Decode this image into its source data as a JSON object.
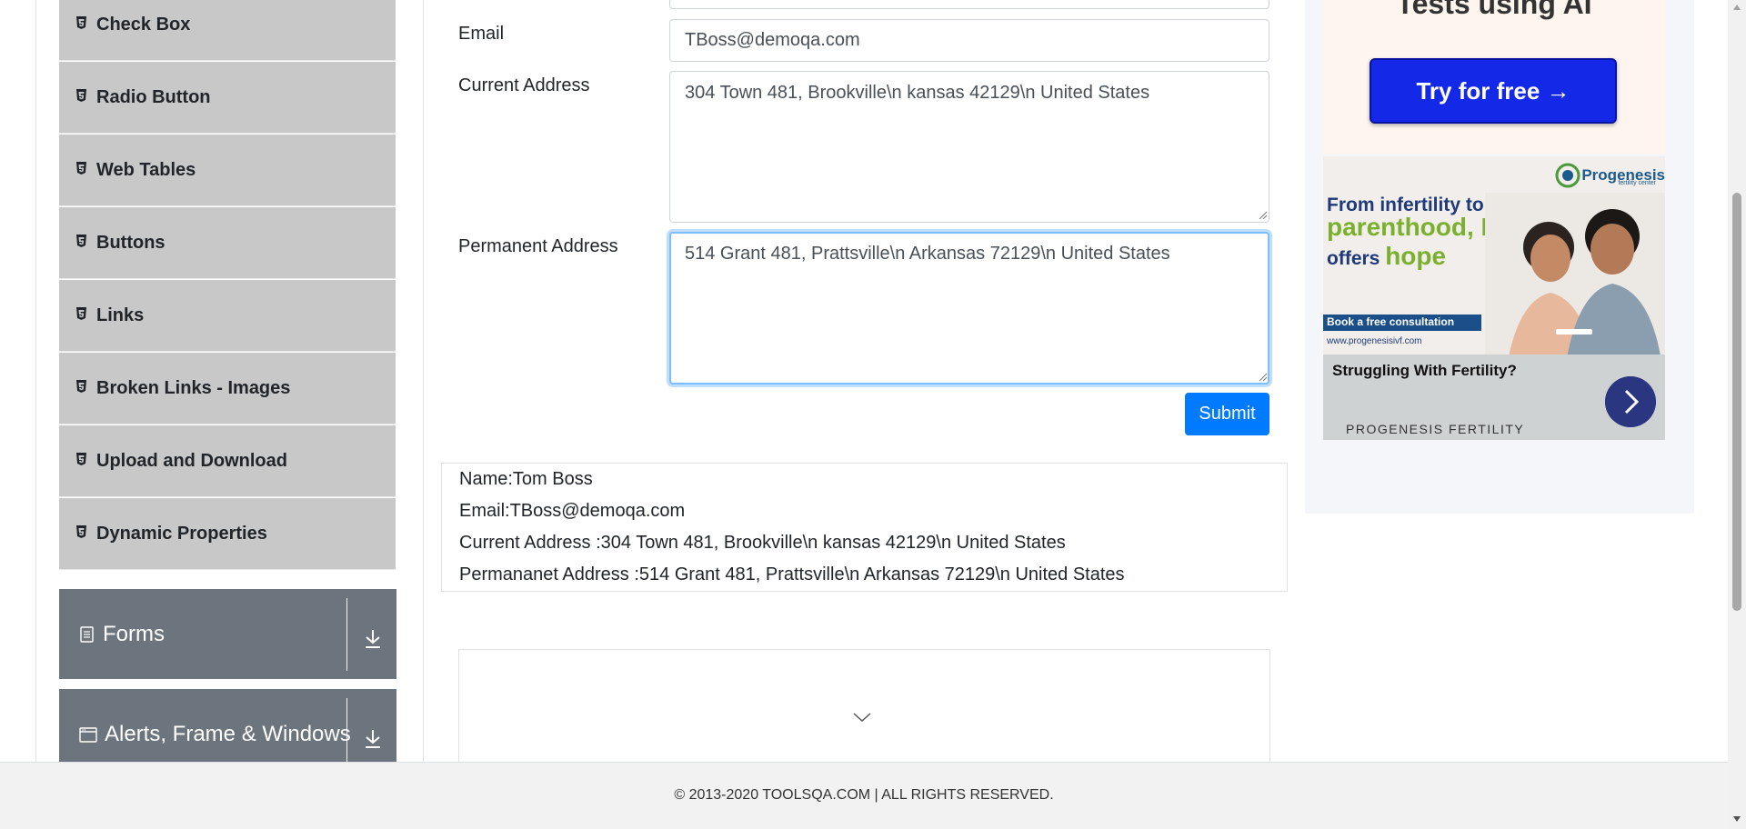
{
  "sidebar": {
    "elements_items": [
      {
        "label": "Check Box"
      },
      {
        "label": "Radio Button"
      },
      {
        "label": "Web Tables"
      },
      {
        "label": "Buttons"
      },
      {
        "label": "Links"
      },
      {
        "label": "Broken Links - Images"
      },
      {
        "label": "Upload and Download"
      },
      {
        "label": "Dynamic Properties"
      }
    ],
    "groups": [
      {
        "label": "Forms"
      },
      {
        "label": "Alerts, Frame & Windows"
      }
    ]
  },
  "form": {
    "email_label": "Email",
    "email_value": "TBoss@demoqa.com",
    "current_address_label": "Current Address",
    "current_address_value": "304 Town 481, Brookville\\n kansas 42129\\n United States",
    "permanent_address_label": "Permanent Address",
    "permanent_address_value": "514 Grant 481, Prattsville\\n Arkansas 72129\\n United States",
    "submit_label": "Submit"
  },
  "output": {
    "name": "Name:Tom Boss",
    "email": "Email:TBoss@demoqa.com",
    "current_address": "Current Address :304 Town 481, Brookville\\n kansas 42129\\n United States",
    "permanent_address": "Permananet Address :514 Grant 481, Prattsville\\n Arkansas 72129\\n United States"
  },
  "ads": {
    "top_title": "Tests using AI",
    "cta_label": "Try for free →",
    "fertility": {
      "logo": "Progenesis",
      "logo_sub": "fertility center",
      "headline_1": "From infertility to",
      "headline_2": "parenthood, IVF",
      "headline_3": "offers",
      "headline_3b": "hope",
      "book": "Book a free consultation",
      "url": "www.progenesisivf.com",
      "question": "Struggling With Fertility?",
      "brand": "PROGENESIS FERTILITY"
    }
  },
  "footer": {
    "copyright": "© 2013-2020 TOOLSQA.COM | ALL RIGHTS RESERVED."
  },
  "colors": {
    "accent": "#007bff",
    "menu_bg": "#c8c8c8",
    "group_bg": "#6c757d",
    "focus_border": "#80bdff"
  },
  "icons": {
    "menu_item": "html5-icon",
    "forms_group": "document-icon",
    "alerts_group": "window-icon",
    "group_toggle": "download-arrow-icon",
    "collapse": "chevron-down-icon"
  }
}
